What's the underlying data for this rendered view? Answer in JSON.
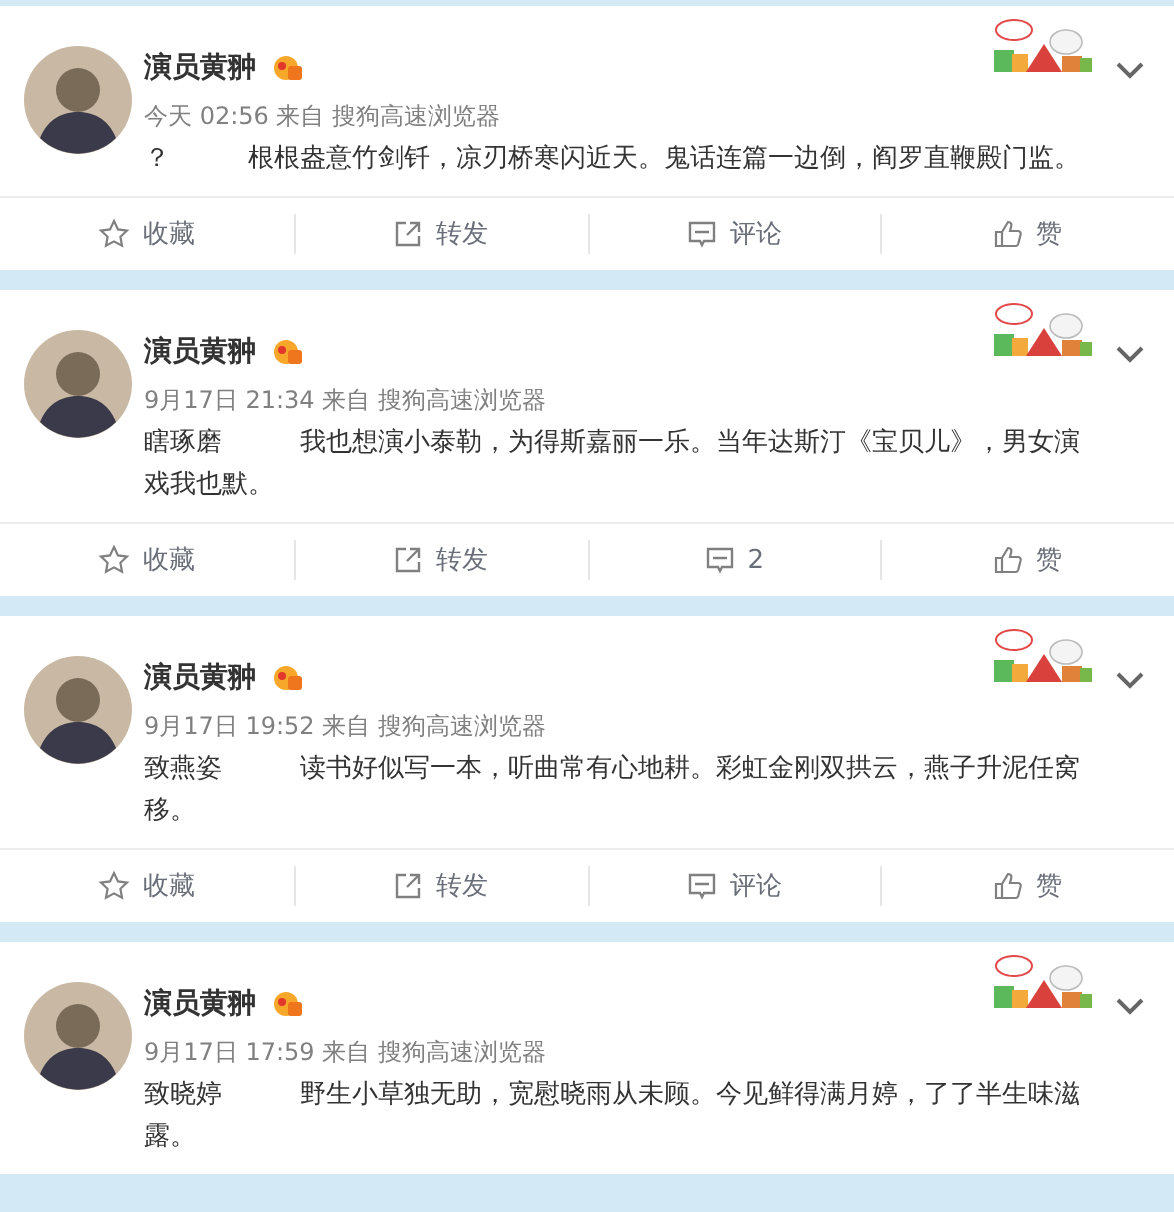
{
  "posts": [
    {
      "author": "演员黄翀",
      "meta": "今天 02:56 来自 搜狗高速浏览器",
      "text": "？　　　根根盎意竹剑钎，凉刃桥寒闪近天。鬼话连篇一边倒，阎罗直鞭殿门监。",
      "actions": [
        {
          "kind": "favorite",
          "label": "收藏"
        },
        {
          "kind": "repost",
          "label": "转发"
        },
        {
          "kind": "comment",
          "label": "评论"
        },
        {
          "kind": "like",
          "label": "赞"
        }
      ]
    },
    {
      "author": "演员黄翀",
      "meta": "9月17日 21:34 来自 搜狗高速浏览器",
      "text": "瞎琢磨　　　我也想演小泰勒，为得斯嘉丽一乐。当年达斯汀《宝贝儿》，男女演戏我也默。",
      "actions": [
        {
          "kind": "favorite",
          "label": "收藏"
        },
        {
          "kind": "repost",
          "label": "转发"
        },
        {
          "kind": "comment",
          "label": "2"
        },
        {
          "kind": "like",
          "label": "赞"
        }
      ]
    },
    {
      "author": "演员黄翀",
      "meta": "9月17日 19:52 来自 搜狗高速浏览器",
      "text": "致燕姿　　　读书好似写一本，听曲常有心地耕。彩虹金刚双拱云，燕子升泥任窝移。",
      "actions": [
        {
          "kind": "favorite",
          "label": "收藏"
        },
        {
          "kind": "repost",
          "label": "转发"
        },
        {
          "kind": "comment",
          "label": "评论"
        },
        {
          "kind": "like",
          "label": "赞"
        }
      ]
    },
    {
      "author": "演员黄翀",
      "meta": "9月17日 17:59 来自 搜狗高速浏览器",
      "text": "致晓婷　　　野生小草独无助，宽慰晓雨从未顾。今见鲜得满月婷，了了半生味滋露。"
    }
  ]
}
